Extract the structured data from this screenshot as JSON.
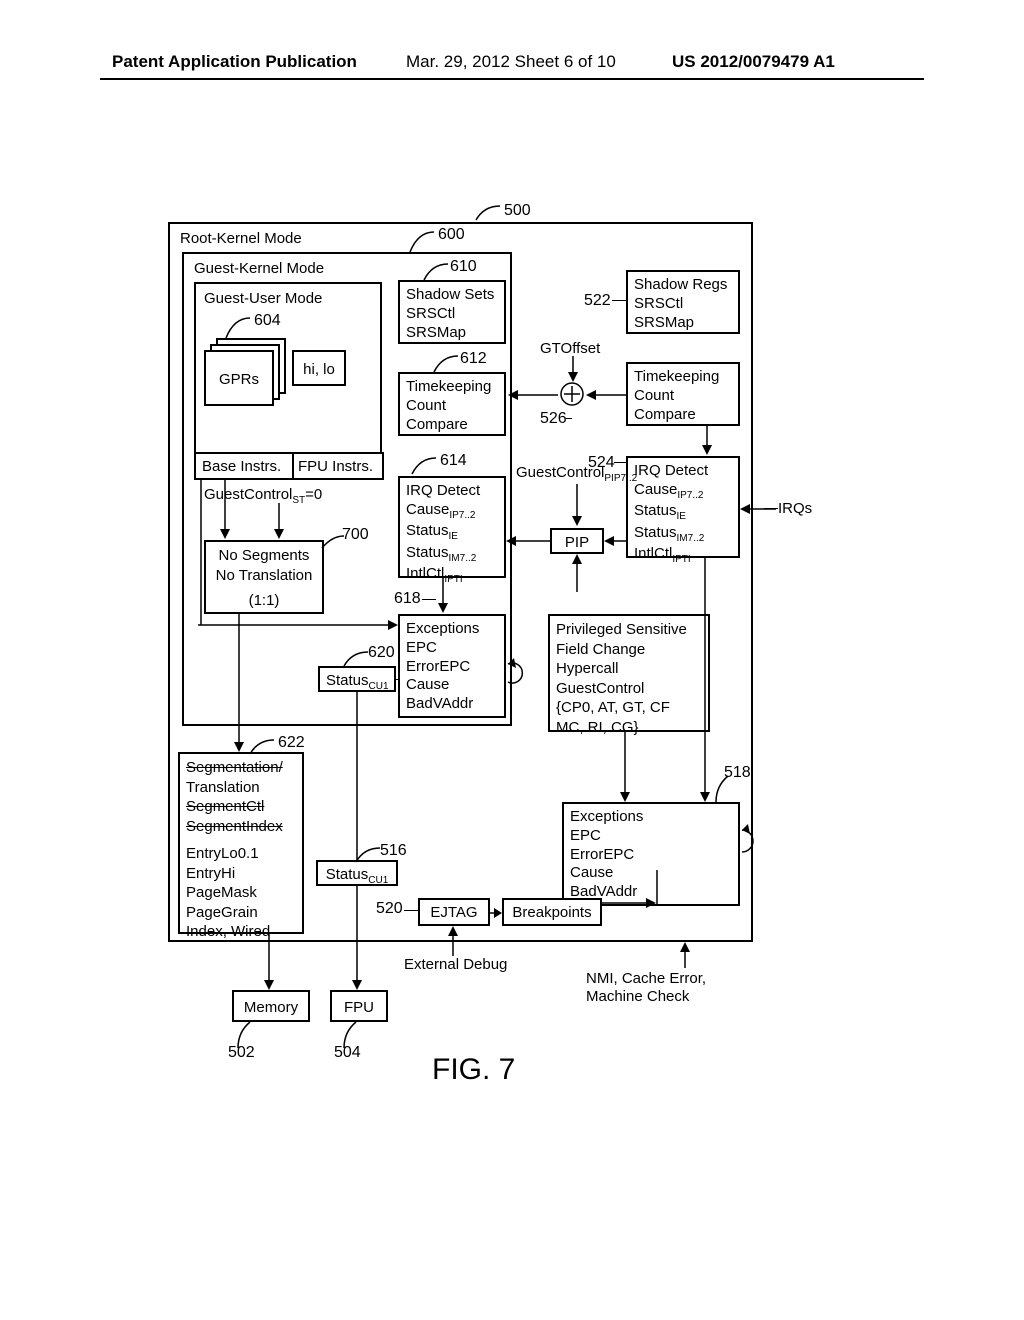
{
  "header": {
    "left": "Patent Application Publication",
    "mid": "Mar. 29, 2012  Sheet 6 of 10",
    "right": "US 2012/0079479 A1"
  },
  "figure": "FIG. 7",
  "refs": {
    "r500": "500",
    "r600": "600",
    "r604": "604",
    "r610": "610",
    "r612": "612",
    "r614": "614",
    "r618": "618",
    "r620": "620",
    "r622": "622",
    "r700": "700",
    "r522": "522",
    "r526": "526",
    "r524": "524",
    "r516": "516",
    "r520": "520",
    "r518": "518",
    "r502": "502",
    "r504": "504"
  },
  "modes": {
    "root": "Root-Kernel Mode",
    "gkernel": "Guest-Kernel Mode",
    "guser": "Guest-User Mode"
  },
  "gprs": {
    "a": "GPRs",
    "b": "hi, lo"
  },
  "instrs": {
    "base": "Base Instrs.",
    "fpu": "FPU Instrs."
  },
  "gcstrl": "GuestControl",
  "gcstrl_st": "=0",
  "noseg": {
    "a": "No Segments",
    "b": "No Translation",
    "c": "(1:1)"
  },
  "shadow_g": {
    "t": "Shadow Sets",
    "a": "SRSCtl",
    "b": "SRSMap"
  },
  "shadow_r": {
    "t": "Shadow Regs",
    "a": "SRSCtl",
    "b": "SRSMap"
  },
  "time_g": {
    "t": "Timekeeping",
    "a": "Count",
    "b": "Compare"
  },
  "time_r": {
    "t": "Timekeeping",
    "a": "Count",
    "b": "Compare"
  },
  "gtoffset": "GTOffset",
  "irq_g": {
    "t": "IRQ Detect",
    "a": "Cause",
    "asub": "IP7..2",
    "b": "Status",
    "bsub": "IE",
    "c": "Status",
    "csub": "IM7..2",
    "d": "IntlCtl",
    "dsub": "IPTI"
  },
  "irq_r": {
    "t": "IRQ Detect",
    "a": "Cause",
    "asub": "IP7..2",
    "b": "Status",
    "bsub": "IE",
    "c": "Status",
    "csub": "IM7..2",
    "d": "IntlCtl",
    "dsub": "IPTI"
  },
  "gcpip": "GuestControl",
  "gcpip_sub": "PIP7..2",
  "pip": "PIP",
  "irqs": "IRQs",
  "exc_g": {
    "t": "Exceptions",
    "a": "EPC",
    "b": "ErrorEPC",
    "c": "Cause",
    "d": "BadVAddr"
  },
  "exc_r": {
    "t": "Exceptions",
    "a": "EPC",
    "b": "ErrorEPC",
    "c": "Cause",
    "d": "BadVAddr"
  },
  "status_cu1_g": "Status",
  "status_cu1_gsub": "CU1",
  "status_cu1_r": "Status",
  "status_cu1_rsub": "CU1",
  "priv": {
    "a": "Privileged Sensitive",
    "b": "Field Change",
    "c": "Hypercall",
    "d": "GuestControl",
    "e": "{CP0, AT, GT, CF",
    "f": "MC, RI, CG}"
  },
  "seg": {
    "a": "Segmentation/",
    "b": "Translation",
    "c": "SegmentCtl",
    "d": "SegmentIndex",
    "e": "EntryLo0.1",
    "f": "EntryHi",
    "g": "PageMask",
    "h": "PageGrain",
    "i": "Index, Wired"
  },
  "ejtag": "EJTAG",
  "bkpt": "Breakpoints",
  "extdbg": "External Debug",
  "nmi": {
    "a": "NMI, Cache Error,",
    "b": "Machine Check"
  },
  "mem": "Memory",
  "fpu": "FPU"
}
